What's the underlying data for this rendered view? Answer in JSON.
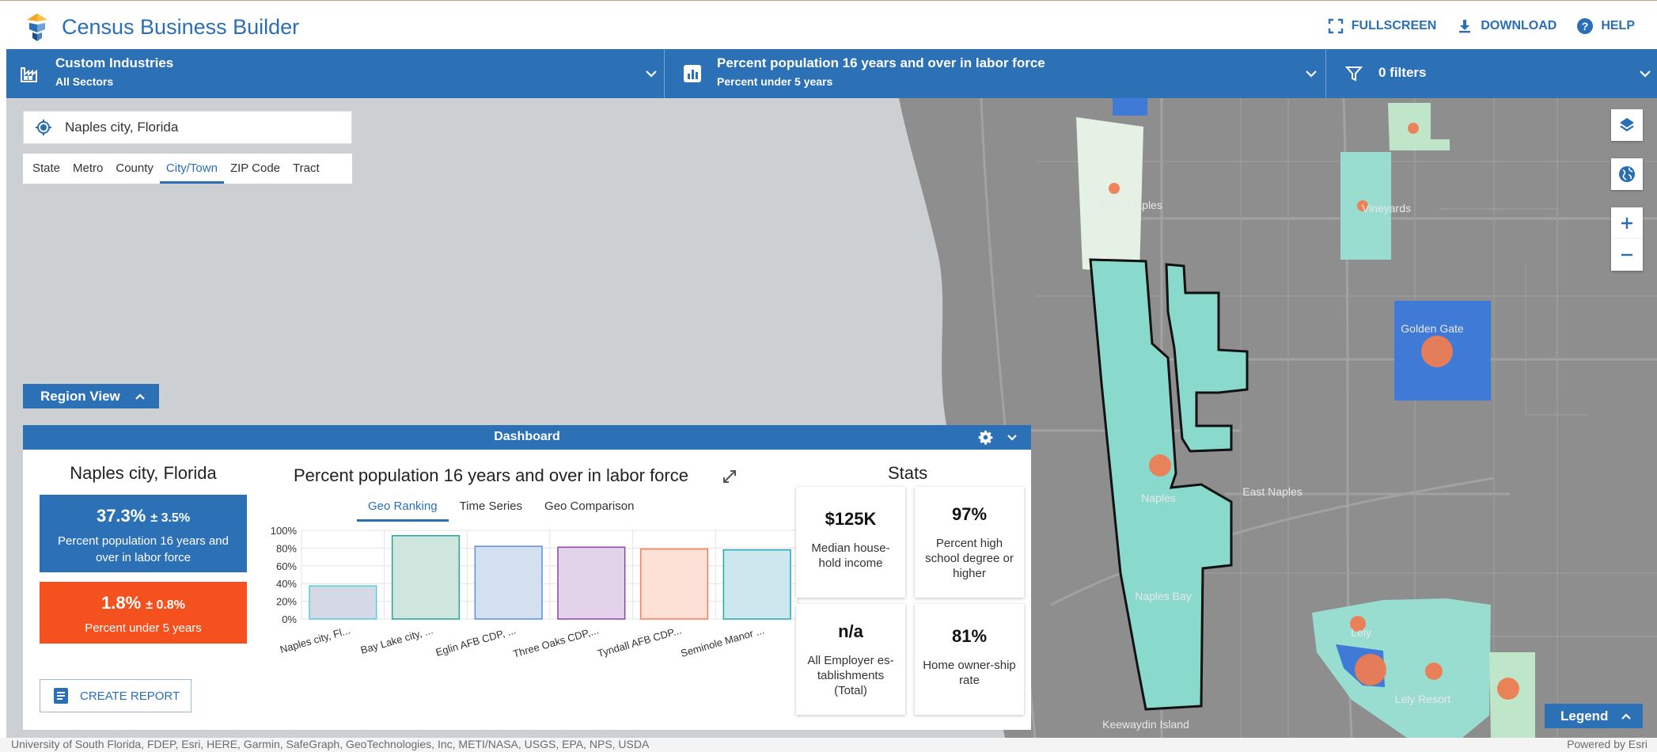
{
  "app": {
    "title": "Census Business Builder",
    "actions": [
      {
        "label": "FULLSCREEN",
        "icon": "fullscreen-icon"
      },
      {
        "label": "DOWNLOAD",
        "icon": "download-icon"
      },
      {
        "label": "HELP",
        "icon": "help-icon"
      }
    ]
  },
  "toolbar": {
    "industry": {
      "title": "Custom Industries",
      "subtitle": "All Sectors"
    },
    "variable": {
      "title": "Percent population 16 years and over in labor force",
      "subtitle": "Percent under 5 years"
    },
    "filters": {
      "title": "0 filters"
    }
  },
  "search": {
    "value": "Naples city, Florida"
  },
  "geo_tabs": [
    "State",
    "Metro",
    "County",
    "City/Town",
    "ZIP Code",
    "Tract"
  ],
  "geo_tab_active": "City/Town",
  "region_view": {
    "label": "Region View"
  },
  "map": {
    "labels": [
      "North Naples",
      "Vineyards",
      "Golden Gate",
      "Naples",
      "East Naples",
      "Naples Bay",
      "Lely",
      "Lely Resort",
      "Keewaydin Island"
    ],
    "legend_label": "Legend",
    "attribution": "University of South Florida, FDEP, Esri, HERE, Garmin, SafeGraph, GeoTechnologies, Inc, METI/NASA, USGS, EPA, NPS, USDA",
    "powered_by": "Powered by Esri"
  },
  "dashboard": {
    "title": "Dashboard",
    "place": "Naples city, Florida",
    "primary": {
      "value": "37.3%",
      "moe": "± 3.5%",
      "label": "Percent population 16 years and over in labor force",
      "color": "#2c70b6"
    },
    "secondary": {
      "value": "1.8%",
      "moe": "± 0.8%",
      "label": "Percent under 5 years",
      "color": "#f4511e"
    },
    "report_label": "CREATE REPORT",
    "chart_title": "Percent population 16 years and over in labor force",
    "chart_tabs": [
      "Geo Ranking",
      "Time Series",
      "Geo Comparison"
    ],
    "chart_tab_active": "Geo Ranking",
    "stats_title": "Stats",
    "stats": [
      {
        "value": "$125K",
        "label": "Median house-hold income"
      },
      {
        "value": "97%",
        "label": "Percent high school degree or higher"
      },
      {
        "value": "n/a",
        "label": "All Employer es-tablishments (Total)"
      },
      {
        "value": "81%",
        "label": "Home owner-ship rate"
      }
    ]
  },
  "chart_data": {
    "type": "bar",
    "title": "Percent population 16 years and over in labor force",
    "categories": [
      "Naples city, Fl...",
      "Bay Lake city, ...",
      "Eglin AFB CDP, ...",
      "Three Oaks CDP,...",
      "Tyndall AFB CDP...",
      "Seminole Manor ..."
    ],
    "values": [
      37.3,
      94,
      82,
      81,
      79,
      78
    ],
    "ylim": [
      0,
      100
    ],
    "yticks": [
      "0%",
      "20%",
      "40%",
      "60%",
      "80%",
      "100%"
    ],
    "colors": [
      "#4dd0e1",
      "#26a69a",
      "#5c8fd6",
      "#8e44ad",
      "#ff7b52",
      "#26a6b4"
    ],
    "fills": [
      "#d5d9e6",
      "#cfe6df",
      "#d3e0ef",
      "#e2d3ea",
      "#fde0d6",
      "#cde7ee"
    ],
    "grid": true
  }
}
